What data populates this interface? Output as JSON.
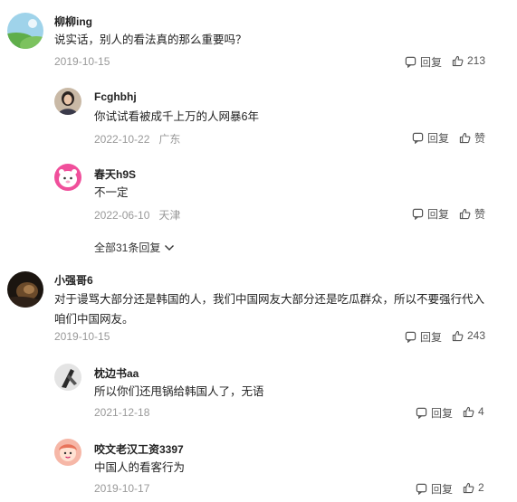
{
  "labels": {
    "reply": "回复",
    "like": "赞"
  },
  "comments": [
    {
      "name": "柳柳ing",
      "text": "说实话，别人的看法真的那么重要吗？",
      "date": "2019-10-15",
      "location": "",
      "likes": "213",
      "replies": [
        {
          "name": "Fcghbhj",
          "text": "你试试看被成千上万的人网暴6年",
          "date": "2022-10-22",
          "location": "广东",
          "likes": "赞"
        },
        {
          "name": "春天h9S",
          "text": "不一定",
          "date": "2022-06-10",
          "location": "天津",
          "likes": "赞"
        }
      ],
      "more_replies": "全部31条回复"
    },
    {
      "name": "小强哥6",
      "text": "对于谩骂大部分还是韩国的人，我们中国网友大部分还是吃瓜群众，所以不要强行代入咱们中国网友。",
      "date": "2019-10-15",
      "location": "",
      "likes": "243",
      "replies": [
        {
          "name": "枕边书aa",
          "text": "所以你们还甩锅给韩国人了，无语",
          "date": "2021-12-18",
          "location": "",
          "likes": "4"
        },
        {
          "name": "咬文老汉工资3397",
          "text": "中国人的看客行为",
          "date": "2019-10-17",
          "location": "",
          "likes": "2"
        }
      ]
    }
  ]
}
